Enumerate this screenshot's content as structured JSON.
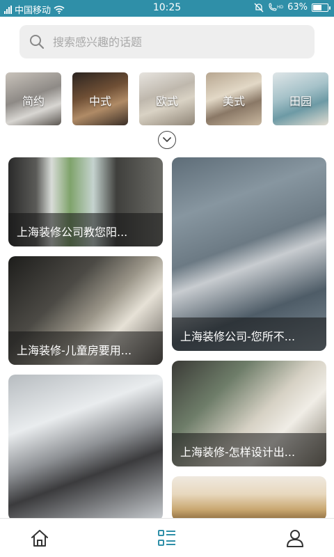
{
  "status_bar": {
    "carrier": "中国移动",
    "time": "10:25",
    "battery": "63%",
    "battery_level": 0.63
  },
  "search": {
    "placeholder": "搜索感兴趣的话题"
  },
  "categories": [
    {
      "label": "简约"
    },
    {
      "label": "中式"
    },
    {
      "label": "欧式"
    },
    {
      "label": "美式"
    },
    {
      "label": "田园"
    }
  ],
  "feed": [
    {
      "caption": "上海装修公司教您阳..."
    },
    {
      "caption": "上海装修公司-您所不..."
    },
    {
      "caption": "上海装修-儿童房要用..."
    },
    {
      "caption": "上海装修-怎样设计出..."
    },
    {
      "caption": ""
    },
    {
      "caption": ""
    }
  ],
  "icons": {
    "search": "search-icon",
    "expand": "chevron-down-icon",
    "home": "home-icon",
    "list": "list-icon",
    "user": "user-icon"
  },
  "colors": {
    "status_bar": "#2f8fa8",
    "active_nav": "#2f8fa8"
  }
}
